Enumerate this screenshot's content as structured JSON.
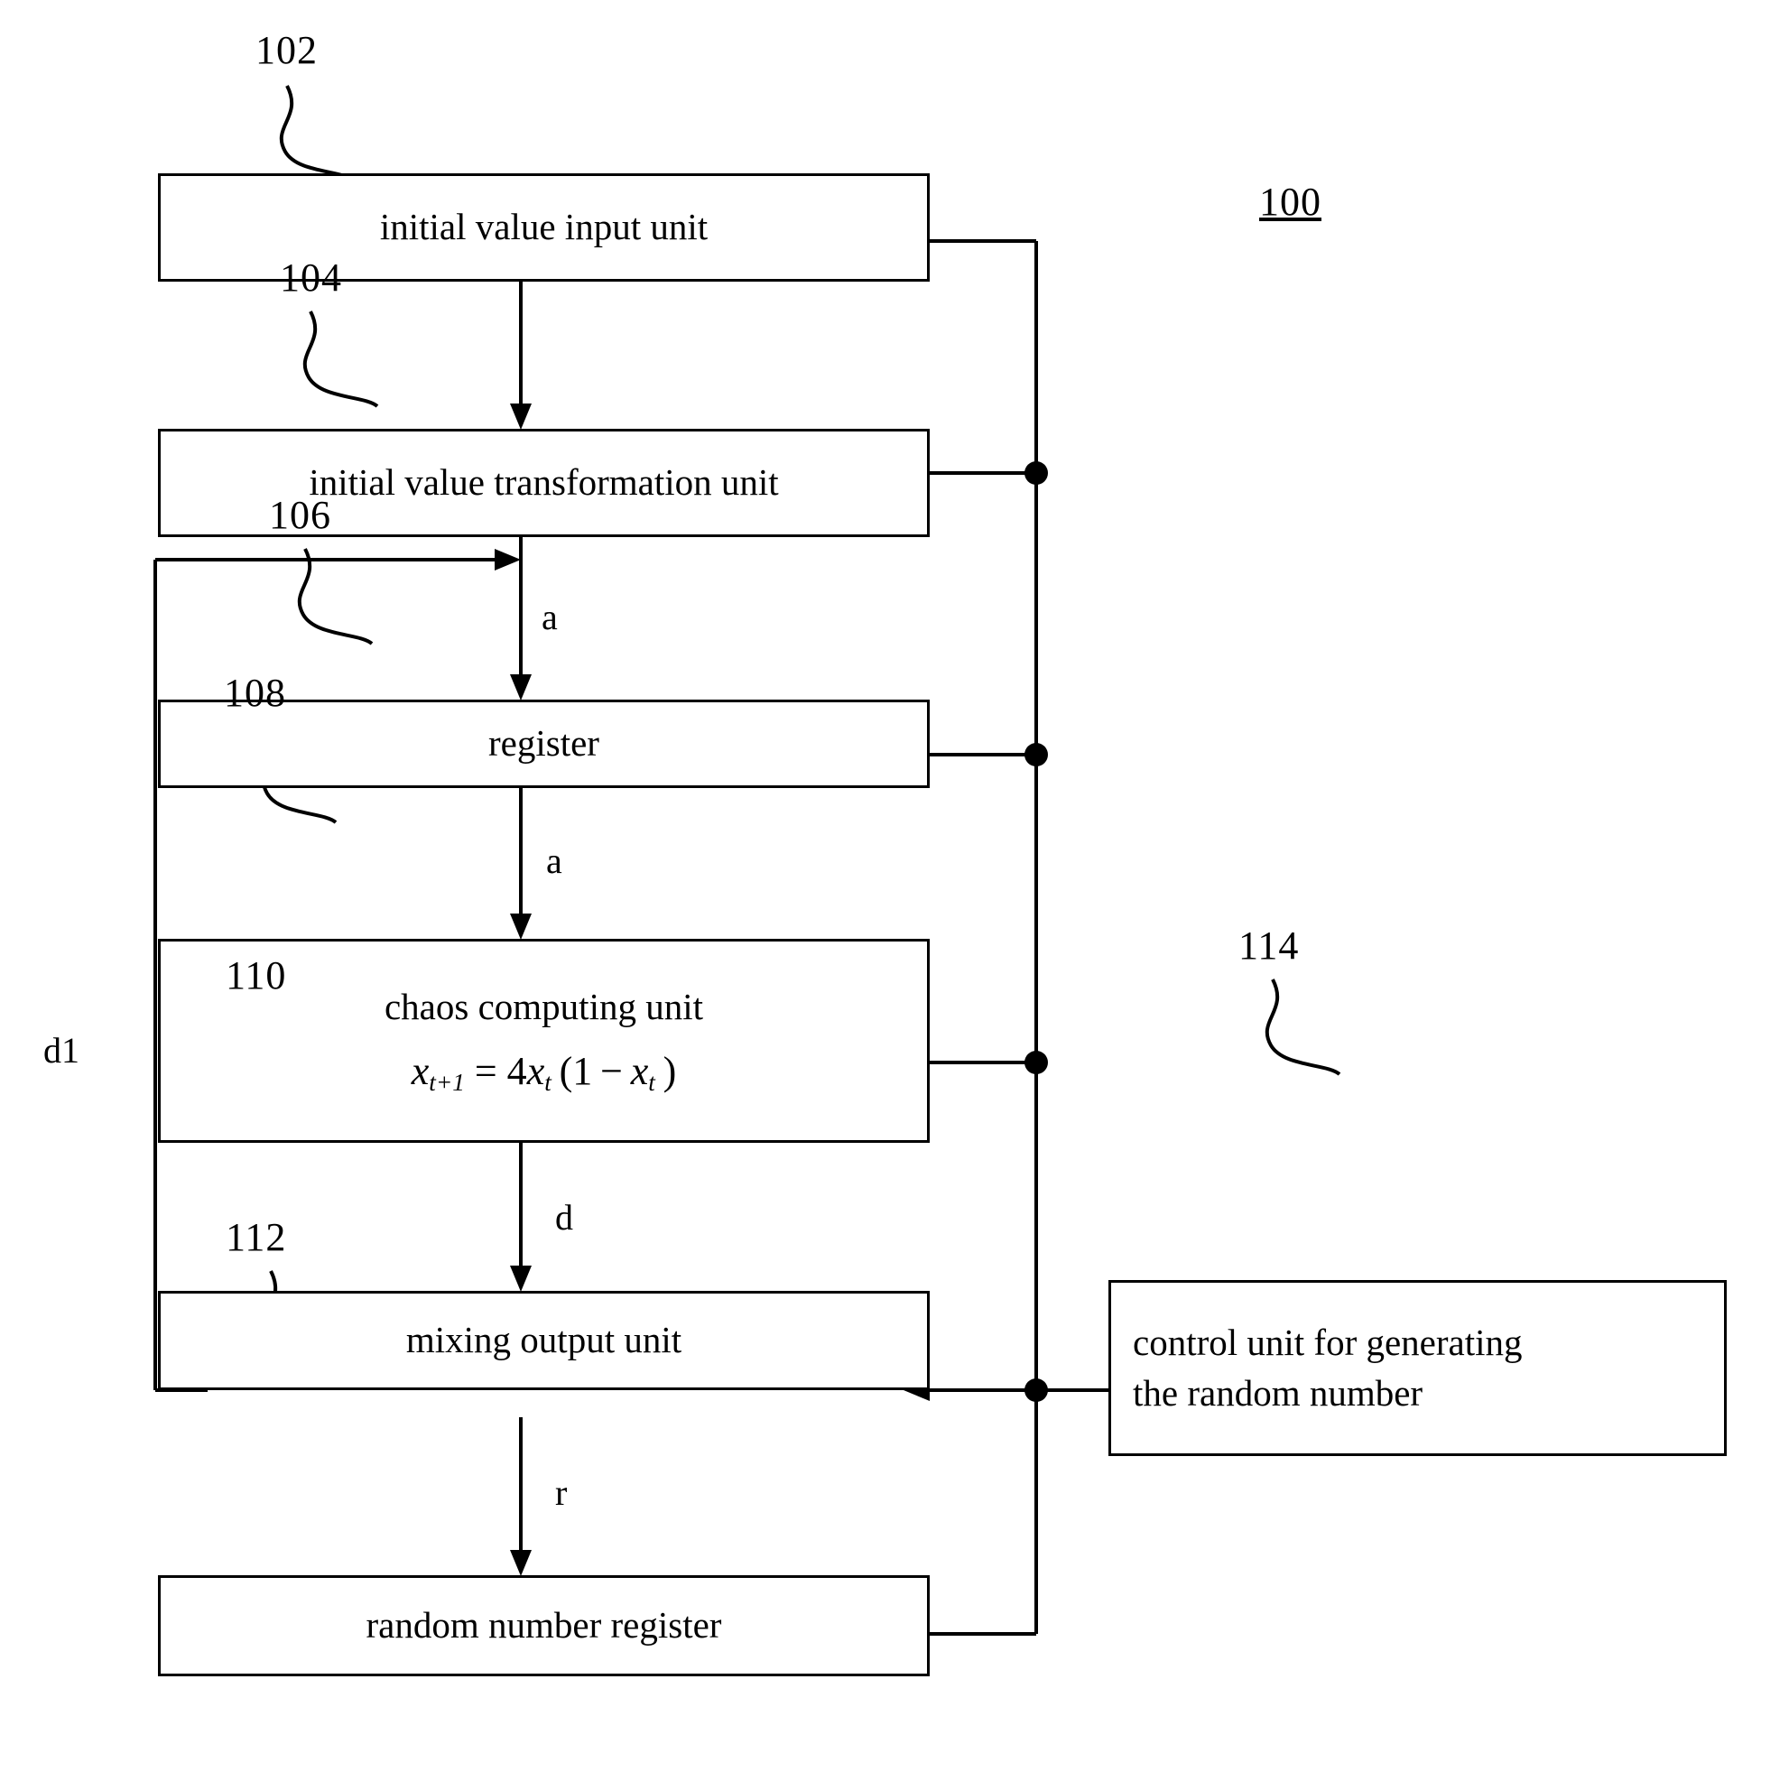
{
  "diagram": {
    "figure_label": "100",
    "blocks": [
      {
        "ref": "102",
        "label": "initial value input unit"
      },
      {
        "ref": "104",
        "label": "initial value transformation unit"
      },
      {
        "ref": "106",
        "label": "register"
      },
      {
        "ref": "108",
        "label": "chaos computing unit",
        "formula_plain": "x t+1 = 4x t (1 - x t )"
      },
      {
        "ref": "110",
        "label": "mixing output unit"
      },
      {
        "ref": "112",
        "label": "random number register"
      },
      {
        "ref": "114",
        "label_line1": "control unit for generating",
        "label_line2": "the random number"
      }
    ],
    "edge_labels": {
      "a1": "a",
      "a2": "a",
      "d": "d",
      "r": "r",
      "d1": "d1"
    },
    "colors": {
      "stroke": "#000000",
      "background": "#ffffff"
    }
  }
}
